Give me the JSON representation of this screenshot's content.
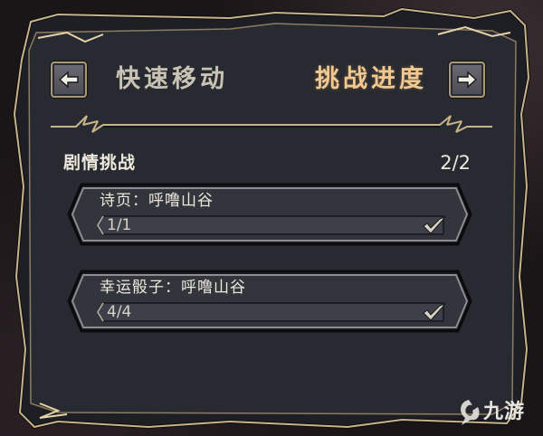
{
  "header": {
    "left_tab_label": "快速移动",
    "right_tab_label": "挑战进度",
    "prev_icon": "arrow-left-icon",
    "next_icon": "arrow-right-icon"
  },
  "section": {
    "title": "剧情挑战",
    "count": "2/2"
  },
  "challenges": [
    {
      "title": "诗页：呼噜山谷",
      "progress": "1/1",
      "progress_fraction": 1.0,
      "completed": true
    },
    {
      "title": "幸运骰子：呼噜山谷",
      "progress": "4/4",
      "progress_fraction": 1.0,
      "completed": true
    }
  ],
  "watermark": {
    "text": "九游"
  },
  "colors": {
    "frame_gold": "#c8b48a",
    "active_tab": "#f0c890",
    "inactive_tab": "#c9c3b5",
    "panel": "#2a2c34",
    "bar": "#3d4048"
  }
}
